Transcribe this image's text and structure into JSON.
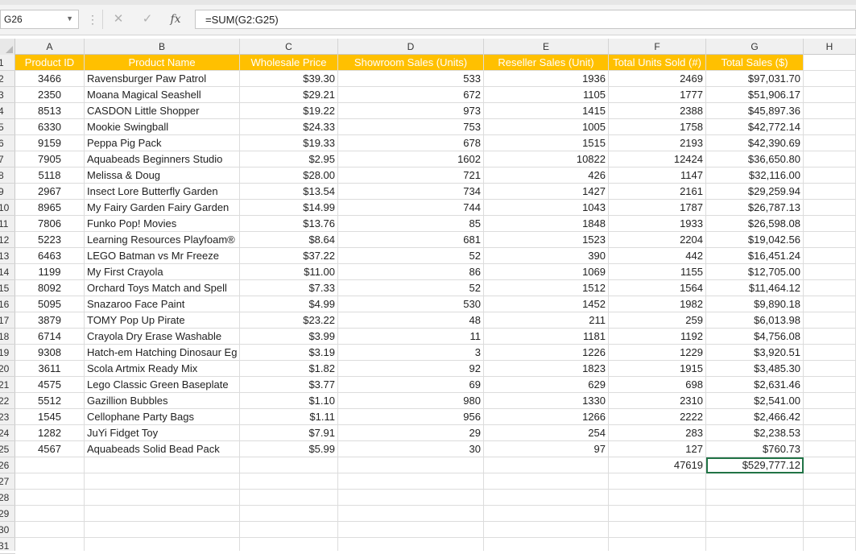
{
  "formula_bar": {
    "name_box": "G26",
    "cancel_icon": "✕",
    "enter_icon": "✓",
    "fx_label": "fx",
    "formula": "=SUM(G2:G25)"
  },
  "columns": [
    "A",
    "B",
    "C",
    "D",
    "E",
    "F",
    "G",
    "H"
  ],
  "rows": [
    "1",
    "2",
    "3",
    "4",
    "5",
    "6",
    "7",
    "8",
    "9",
    "10",
    "11",
    "12",
    "13",
    "14",
    "15",
    "16",
    "17",
    "18",
    "19",
    "20",
    "21",
    "22",
    "23",
    "24",
    "25",
    "26",
    "27",
    "28",
    "29",
    "30",
    "31"
  ],
  "header": [
    "Product ID",
    "Product Name",
    "Wholesale Price",
    "Showroom Sales (Units)",
    "Reseller Sales (Unit)",
    "Total Units Sold (#)",
    "Total Sales ($)"
  ],
  "data": [
    [
      "3466",
      "Ravensburger Paw Patrol",
      "$39.30",
      "533",
      "1936",
      "2469",
      "$97,031.70"
    ],
    [
      "2350",
      "Moana Magical Seashell",
      "$29.21",
      "672",
      "1105",
      "1777",
      "$51,906.17"
    ],
    [
      "8513",
      "CASDON Little Shopper",
      "$19.22",
      "973",
      "1415",
      "2388",
      "$45,897.36"
    ],
    [
      "6330",
      "Mookie Swingball",
      "$24.33",
      "753",
      "1005",
      "1758",
      "$42,772.14"
    ],
    [
      "9159",
      "Peppa Pig Pack",
      "$19.33",
      "678",
      "1515",
      "2193",
      "$42,390.69"
    ],
    [
      "7905",
      "Aquabeads Beginners Studio",
      "$2.95",
      "1602",
      "10822",
      "12424",
      "$36,650.80"
    ],
    [
      "5118",
      "Melissa & Doug",
      "$28.00",
      "721",
      "426",
      "1147",
      "$32,116.00"
    ],
    [
      "2967",
      "Insect Lore Butterfly Garden",
      "$13.54",
      "734",
      "1427",
      "2161",
      "$29,259.94"
    ],
    [
      "8965",
      "My Fairy Garden Fairy Garden",
      "$14.99",
      "744",
      "1043",
      "1787",
      "$26,787.13"
    ],
    [
      "7806",
      "Funko Pop! Movies",
      "$13.76",
      "85",
      "1848",
      "1933",
      "$26,598.08"
    ],
    [
      "5223",
      "Learning Resources Playfoam®",
      "$8.64",
      "681",
      "1523",
      "2204",
      "$19,042.56"
    ],
    [
      "6463",
      "LEGO  Batman vs Mr Freeze",
      "$37.22",
      "52",
      "390",
      "442",
      "$16,451.24"
    ],
    [
      "1199",
      "My First Crayola",
      "$11.00",
      "86",
      "1069",
      "1155",
      "$12,705.00"
    ],
    [
      "8092",
      "Orchard Toys Match and Spell",
      "$7.33",
      "52",
      "1512",
      "1564",
      "$11,464.12"
    ],
    [
      "5095",
      "Snazaroo Face Paint",
      "$4.99",
      "530",
      "1452",
      "1982",
      "$9,890.18"
    ],
    [
      "3879",
      "TOMY Pop Up Pirate",
      "$23.22",
      "48",
      "211",
      "259",
      "$6,013.98"
    ],
    [
      "6714",
      "Crayola Dry Erase Washable",
      "$3.99",
      "11",
      "1181",
      "1192",
      "$4,756.08"
    ],
    [
      "9308",
      "Hatch-em Hatching Dinosaur Eg",
      "$3.19",
      "3",
      "1226",
      "1229",
      "$3,920.51"
    ],
    [
      "3611",
      "Scola Artmix Ready Mix",
      "$1.82",
      "92",
      "1823",
      "1915",
      "$3,485.30"
    ],
    [
      "4575",
      "Lego Classic Green Baseplate",
      "$3.77",
      "69",
      "629",
      "698",
      "$2,631.46"
    ],
    [
      "5512",
      "Gazillion Bubbles",
      "$1.10",
      "980",
      "1330",
      "2310",
      "$2,541.00"
    ],
    [
      "1545",
      "Cellophane Party Bags",
      "$1.11",
      "956",
      "1266",
      "2222",
      "$2,466.42"
    ],
    [
      "1282",
      "JuYi Fidget Toy",
      "$7.91",
      "29",
      "254",
      "283",
      "$2,238.53"
    ],
    [
      "4567",
      "Aquabeads Solid Bead Pack",
      "$5.99",
      "30",
      "97",
      "127",
      "$760.73"
    ]
  ],
  "totals": {
    "units": "47619",
    "sales": "$529,777.12"
  },
  "colors": {
    "header_fill": "#ffc000",
    "header_text": "#ffffff",
    "selection": "#217346"
  }
}
